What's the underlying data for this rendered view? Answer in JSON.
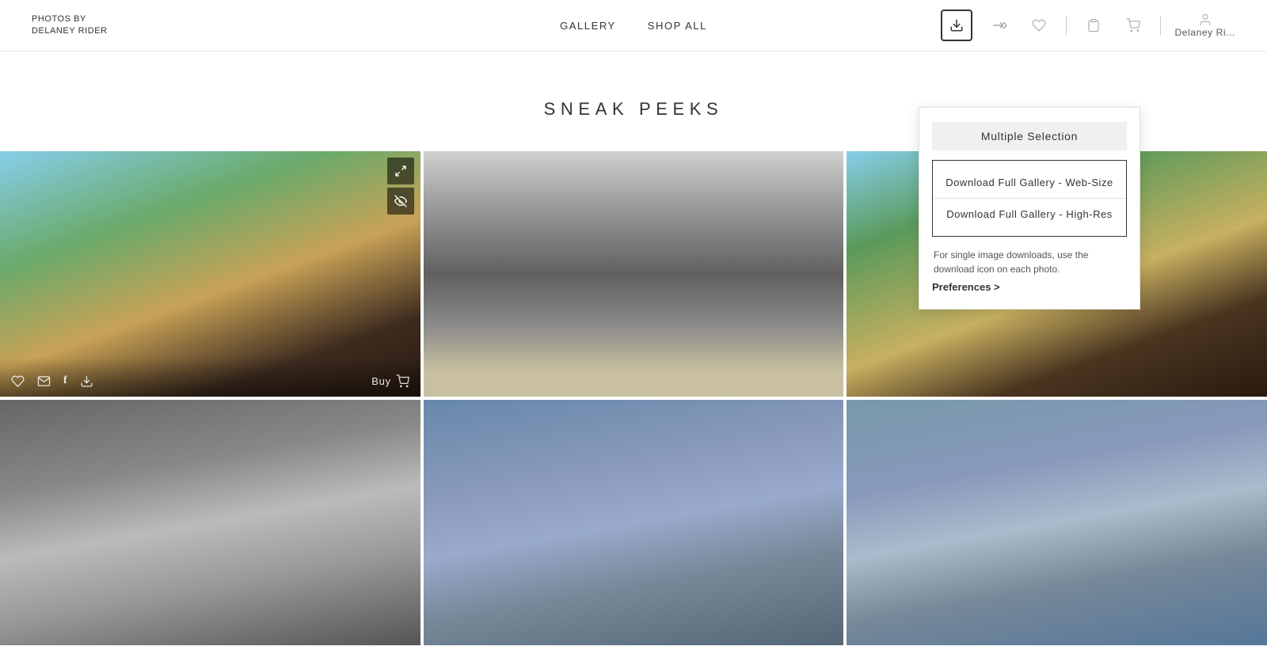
{
  "header": {
    "logo_line1": "PHOTOS BY",
    "logo_line2": "DELANEY RIDER",
    "nav": [
      {
        "label": "GALLERY",
        "id": "gallery"
      },
      {
        "label": "SHOP ALL",
        "id": "shop-all"
      }
    ],
    "user_label": "Delaney Ri...",
    "icons": {
      "download": "⬇",
      "share": "↗",
      "heart": "♡",
      "clipboard": "📋",
      "cart": "🛒",
      "user": "👤"
    }
  },
  "gallery": {
    "title": "SNEAK PEEKS"
  },
  "dropdown": {
    "multiple_selection": "Multiple Selection",
    "download_web": "Download Full Gallery - Web-Size",
    "download_highres": "Download Full Gallery - High-Res",
    "info_text": "For single image downloads, use the download icon on each photo.",
    "preferences_label": "Preferences >"
  },
  "photos": [
    {
      "id": "photo-1",
      "bottom_icons": [
        "♡",
        "✉",
        "f",
        "⬇"
      ],
      "has_top_icons": true
    },
    {
      "id": "photo-2",
      "bottom_icons": [],
      "has_top_icons": false
    },
    {
      "id": "photo-3",
      "bottom_icons": [],
      "has_top_icons": false
    },
    {
      "id": "photo-4",
      "bottom_icons": [],
      "has_top_icons": false
    },
    {
      "id": "photo-5",
      "bottom_icons": [],
      "has_top_icons": false
    },
    {
      "id": "photo-6",
      "bottom_icons": [],
      "has_top_icons": false
    }
  ]
}
